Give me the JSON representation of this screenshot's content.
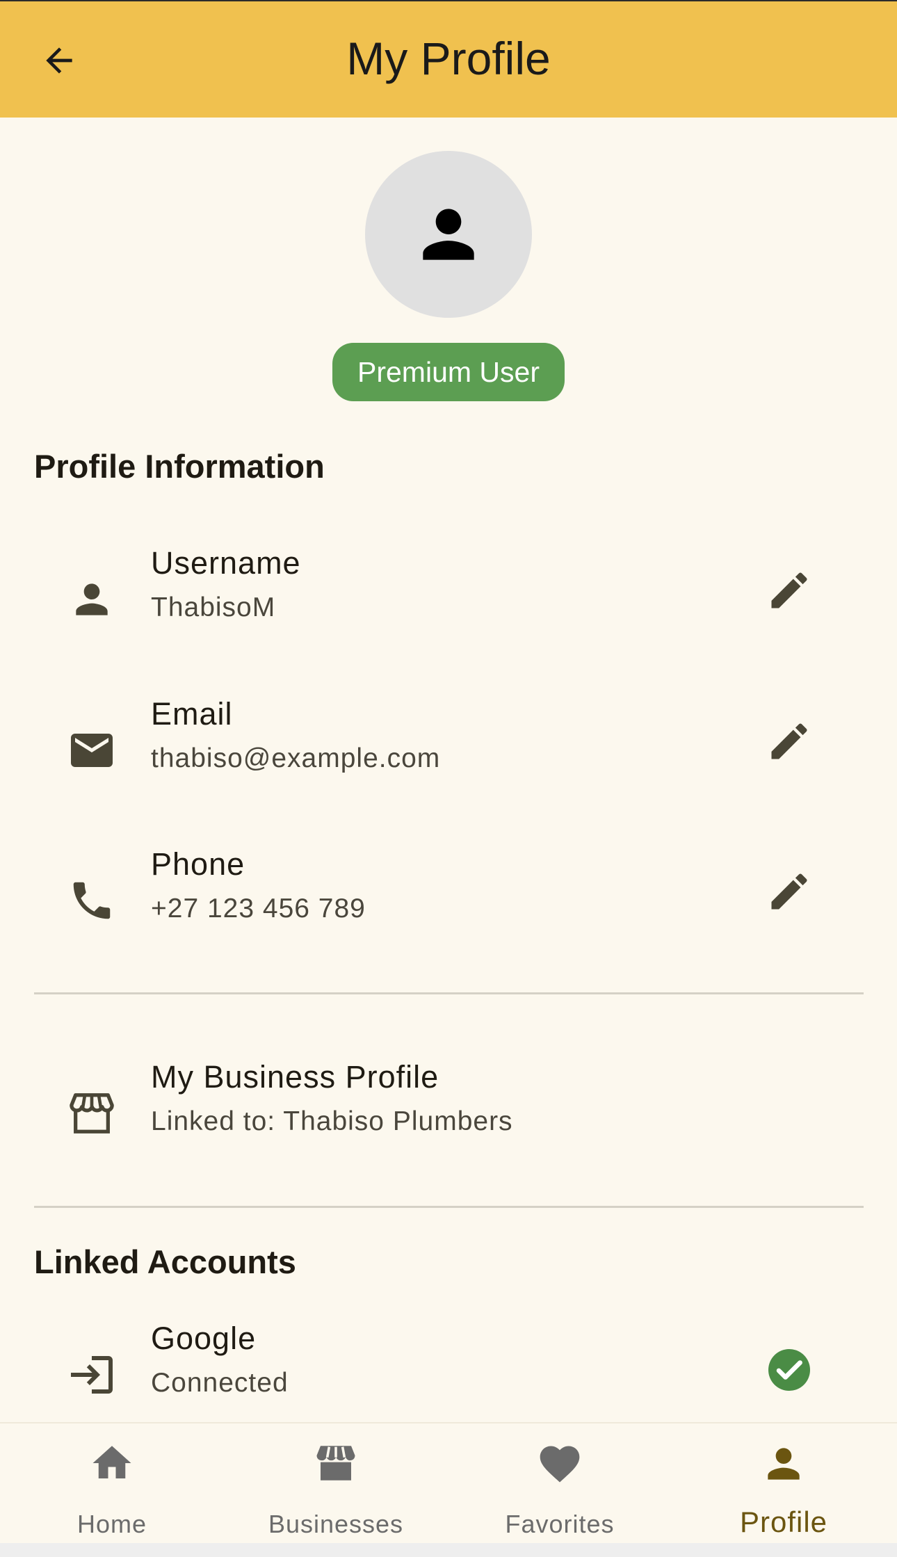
{
  "appbar": {
    "title": "My Profile",
    "back_icon": "arrow-back-icon",
    "color": "#f0c14f"
  },
  "avatar": {
    "icon": "person-icon"
  },
  "badge": {
    "label": "Premium User",
    "color": "#5c9e52"
  },
  "profile_section": {
    "title": "Profile Information",
    "rows": [
      {
        "icon": "person-icon",
        "title": "Username",
        "value": "ThabisoM",
        "action_icon": "edit-icon"
      },
      {
        "icon": "mail-icon",
        "title": "Email",
        "value": "thabiso@example.com",
        "action_icon": "edit-icon"
      },
      {
        "icon": "phone-icon",
        "title": "Phone",
        "value": "+27 123 456 789",
        "action_icon": "edit-icon"
      }
    ]
  },
  "business": {
    "icon": "store-icon",
    "title": "My Business Profile",
    "value": "Linked to: Thabiso Plumbers"
  },
  "linked_section": {
    "title": "Linked Accounts",
    "rows": [
      {
        "icon": "login-icon",
        "title": "Google",
        "value": "Connected",
        "status_icon": "check-circle-icon",
        "status_color": "#4a8c45"
      }
    ]
  },
  "nav": {
    "items": [
      {
        "label": "Home",
        "icon": "home-icon",
        "active": false
      },
      {
        "label": "Businesses",
        "icon": "store-icon",
        "active": false
      },
      {
        "label": "Favorites",
        "icon": "heart-icon",
        "active": false
      },
      {
        "label": "Profile",
        "icon": "person-icon",
        "active": true
      }
    ],
    "active_color": "#6b5510"
  }
}
